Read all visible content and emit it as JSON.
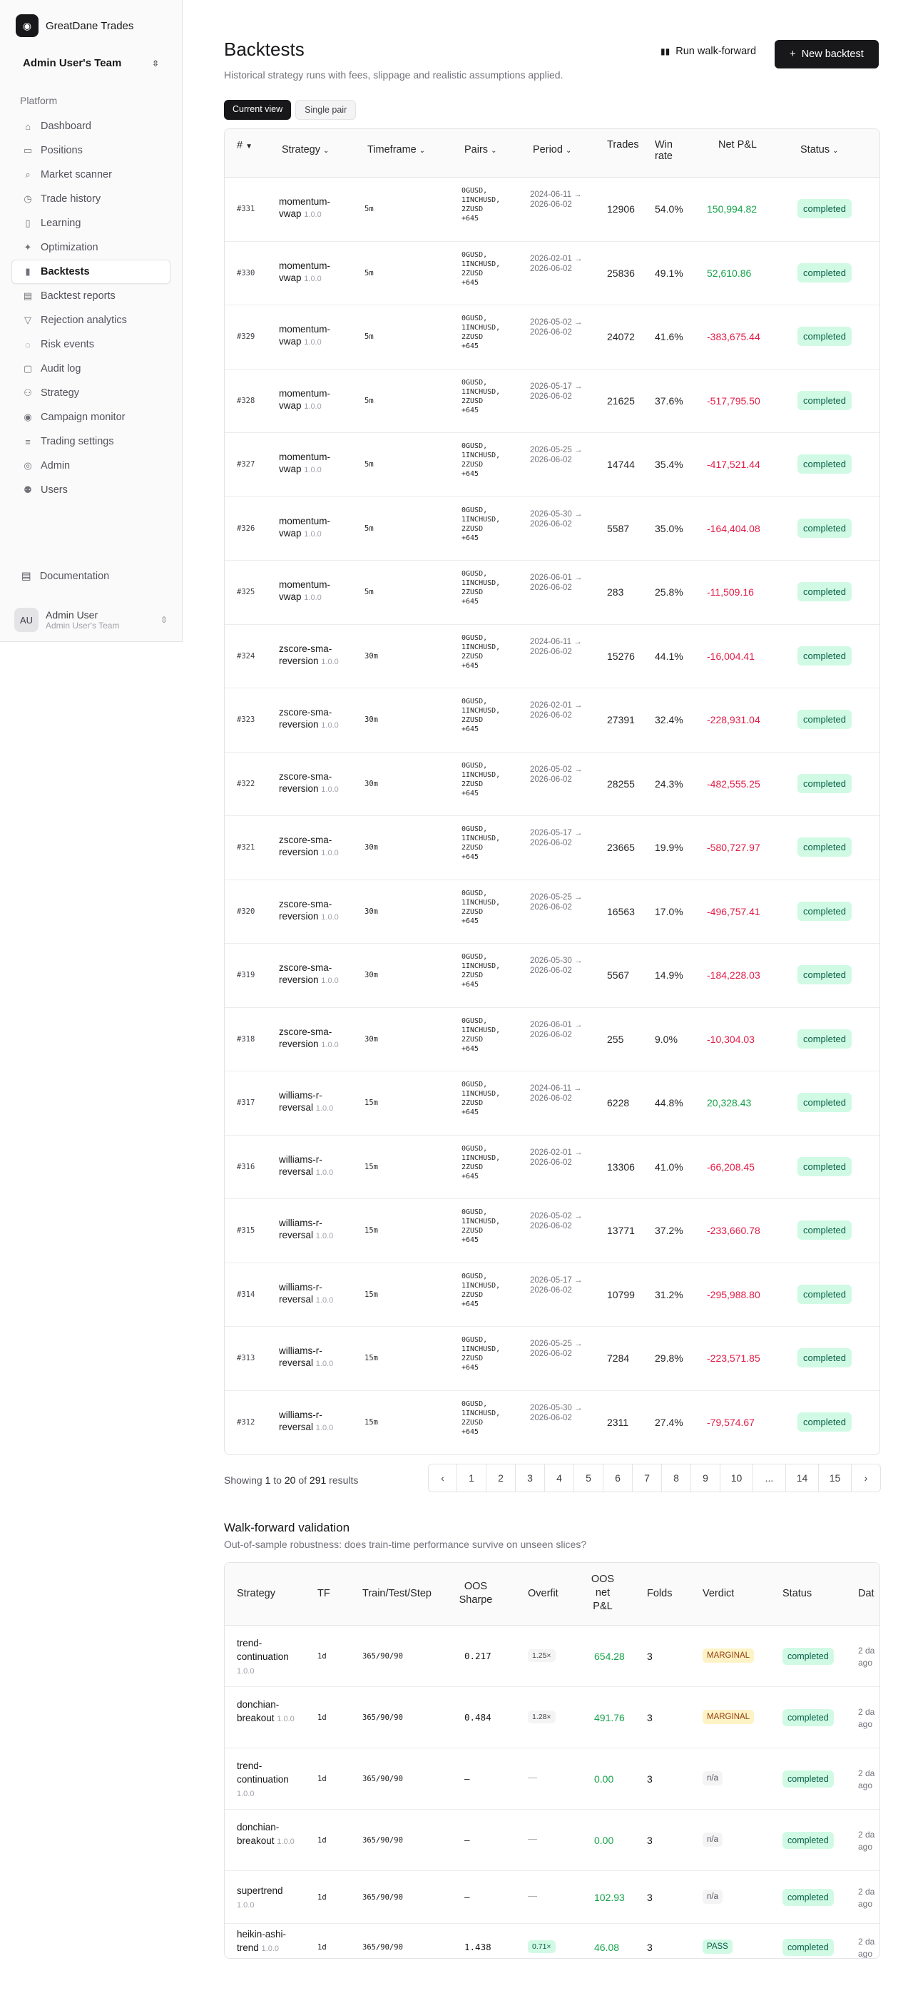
{
  "brand": {
    "name": "GreatDane Trades",
    "logo_icon": "dog-icon"
  },
  "team": {
    "name": "Admin User's Team"
  },
  "nav": {
    "section": "Platform",
    "items": [
      {
        "label": "Dashboard",
        "icon": "home-icon",
        "glyph": "⌂"
      },
      {
        "label": "Positions",
        "icon": "briefcase-icon",
        "glyph": "▭"
      },
      {
        "label": "Market scanner",
        "icon": "search-icon",
        "glyph": "⌕"
      },
      {
        "label": "Trade history",
        "icon": "clock-icon",
        "glyph": "◷"
      },
      {
        "label": "Learning",
        "icon": "book-icon",
        "glyph": "▯"
      },
      {
        "label": "Optimization",
        "icon": "sparkles-icon",
        "glyph": "✦"
      },
      {
        "label": "Backtests",
        "icon": "bar-chart-icon",
        "glyph": "▮",
        "active": true
      },
      {
        "label": "Backtest reports",
        "icon": "report-icon",
        "glyph": "▤"
      },
      {
        "label": "Rejection analytics",
        "icon": "filter-icon",
        "glyph": "▽"
      },
      {
        "label": "Risk events",
        "icon": "alert-icon",
        "glyph": "◌"
      },
      {
        "label": "Audit log",
        "icon": "file-icon",
        "glyph": "▢"
      },
      {
        "label": "Strategy",
        "icon": "strategy-icon",
        "glyph": "⚇"
      },
      {
        "label": "Campaign monitor",
        "icon": "radio-icon",
        "glyph": "◉"
      },
      {
        "label": "Trading settings",
        "icon": "sliders-icon",
        "glyph": "≡"
      },
      {
        "label": "Admin",
        "icon": "shield-icon",
        "glyph": "◎"
      },
      {
        "label": "Users",
        "icon": "users-icon",
        "glyph": "⚉"
      }
    ],
    "documentation": "Documentation"
  },
  "user": {
    "initials": "AU",
    "name": "Admin User",
    "team": "Admin User's Team"
  },
  "page": {
    "title": "Backtests",
    "subtitle": "Historical strategy runs with fees, slippage and realistic assumptions applied.",
    "walk_forward_button": "Run walk-forward",
    "new_button": "New backtest",
    "views": [
      "Current view",
      "Single pair"
    ]
  },
  "backtests": {
    "headers": {
      "id": "#",
      "strategy": "Strategy",
      "timeframe": "Timeframe",
      "pairs": "Pairs",
      "period": "Period",
      "trades": "Trades",
      "win_rate": "Win rate",
      "net_pnl": "Net P&L",
      "status": "Status"
    },
    "rows": [
      {
        "id": "#331",
        "strategy": "momentum-vwap",
        "version": "1.0.0",
        "tf": "5m",
        "pairs": "0GUSD,\n1INCHUSD,\n2ZUSD\n+645",
        "period": "2024-06-11 → 2026-06-02",
        "trades": "12906",
        "win": "54.0%",
        "pnl": "150,994.82",
        "sign": "pos",
        "status": "completed"
      },
      {
        "id": "#330",
        "strategy": "momentum-vwap",
        "version": "1.0.0",
        "tf": "5m",
        "pairs": "0GUSD,\n1INCHUSD,\n2ZUSD\n+645",
        "period": "2026-02-01 → 2026-06-02",
        "trades": "25836",
        "win": "49.1%",
        "pnl": "52,610.86",
        "sign": "pos",
        "status": "completed"
      },
      {
        "id": "#329",
        "strategy": "momentum-vwap",
        "version": "1.0.0",
        "tf": "5m",
        "pairs": "0GUSD,\n1INCHUSD,\n2ZUSD\n+645",
        "period": "2026-05-02 → 2026-06-02",
        "trades": "24072",
        "win": "41.6%",
        "pnl": "-383,675.44",
        "sign": "neg",
        "status": "completed"
      },
      {
        "id": "#328",
        "strategy": "momentum-vwap",
        "version": "1.0.0",
        "tf": "5m",
        "pairs": "0GUSD,\n1INCHUSD,\n2ZUSD\n+645",
        "period": "2026-05-17 → 2026-06-02",
        "trades": "21625",
        "win": "37.6%",
        "pnl": "-517,795.50",
        "sign": "neg",
        "status": "completed"
      },
      {
        "id": "#327",
        "strategy": "momentum-vwap",
        "version": "1.0.0",
        "tf": "5m",
        "pairs": "0GUSD,\n1INCHUSD,\n2ZUSD\n+645",
        "period": "2026-05-25 → 2026-06-02",
        "trades": "14744",
        "win": "35.4%",
        "pnl": "-417,521.44",
        "sign": "neg",
        "status": "completed"
      },
      {
        "id": "#326",
        "strategy": "momentum-vwap",
        "version": "1.0.0",
        "tf": "5m",
        "pairs": "0GUSD,\n1INCHUSD,\n2ZUSD\n+645",
        "period": "2026-05-30 → 2026-06-02",
        "trades": "5587",
        "win": "35.0%",
        "pnl": "-164,404.08",
        "sign": "neg",
        "status": "completed"
      },
      {
        "id": "#325",
        "strategy": "momentum-vwap",
        "version": "1.0.0",
        "tf": "5m",
        "pairs": "0GUSD,\n1INCHUSD,\n2ZUSD\n+645",
        "period": "2026-06-01 → 2026-06-02",
        "trades": "283",
        "win": "25.8%",
        "pnl": "-11,509.16",
        "sign": "neg",
        "status": "completed"
      },
      {
        "id": "#324",
        "strategy": "zscore-sma-reversion",
        "version": "1.0.0",
        "tf": "30m",
        "pairs": "0GUSD,\n1INCHUSD,\n2ZUSD\n+645",
        "period": "2024-06-11 → 2026-06-02",
        "trades": "15276",
        "win": "44.1%",
        "pnl": "-16,004.41",
        "sign": "neg",
        "status": "completed"
      },
      {
        "id": "#323",
        "strategy": "zscore-sma-reversion",
        "version": "1.0.0",
        "tf": "30m",
        "pairs": "0GUSD,\n1INCHUSD,\n2ZUSD\n+645",
        "period": "2026-02-01 → 2026-06-02",
        "trades": "27391",
        "win": "32.4%",
        "pnl": "-228,931.04",
        "sign": "neg",
        "status": "completed"
      },
      {
        "id": "#322",
        "strategy": "zscore-sma-reversion",
        "version": "1.0.0",
        "tf": "30m",
        "pairs": "0GUSD,\n1INCHUSD,\n2ZUSD\n+645",
        "period": "2026-05-02 → 2026-06-02",
        "trades": "28255",
        "win": "24.3%",
        "pnl": "-482,555.25",
        "sign": "neg",
        "status": "completed"
      },
      {
        "id": "#321",
        "strategy": "zscore-sma-reversion",
        "version": "1.0.0",
        "tf": "30m",
        "pairs": "0GUSD,\n1INCHUSD,\n2ZUSD\n+645",
        "period": "2026-05-17 → 2026-06-02",
        "trades": "23665",
        "win": "19.9%",
        "pnl": "-580,727.97",
        "sign": "neg",
        "status": "completed"
      },
      {
        "id": "#320",
        "strategy": "zscore-sma-reversion",
        "version": "1.0.0",
        "tf": "30m",
        "pairs": "0GUSD,\n1INCHUSD,\n2ZUSD\n+645",
        "period": "2026-05-25 → 2026-06-02",
        "trades": "16563",
        "win": "17.0%",
        "pnl": "-496,757.41",
        "sign": "neg",
        "status": "completed"
      },
      {
        "id": "#319",
        "strategy": "zscore-sma-reversion",
        "version": "1.0.0",
        "tf": "30m",
        "pairs": "0GUSD,\n1INCHUSD,\n2ZUSD\n+645",
        "period": "2026-05-30 → 2026-06-02",
        "trades": "5567",
        "win": "14.9%",
        "pnl": "-184,228.03",
        "sign": "neg",
        "status": "completed"
      },
      {
        "id": "#318",
        "strategy": "zscore-sma-reversion",
        "version": "1.0.0",
        "tf": "30m",
        "pairs": "0GUSD,\n1INCHUSD,\n2ZUSD\n+645",
        "period": "2026-06-01 → 2026-06-02",
        "trades": "255",
        "win": "9.0%",
        "pnl": "-10,304.03",
        "sign": "neg",
        "status": "completed"
      },
      {
        "id": "#317",
        "strategy": "williams-r-reversal",
        "version": "1.0.0",
        "tf": "15m",
        "pairs": "0GUSD,\n1INCHUSD,\n2ZUSD\n+645",
        "period": "2024-06-11 → 2026-06-02",
        "trades": "6228",
        "win": "44.8%",
        "pnl": "20,328.43",
        "sign": "pos",
        "status": "completed"
      },
      {
        "id": "#316",
        "strategy": "williams-r-reversal",
        "version": "1.0.0",
        "tf": "15m",
        "pairs": "0GUSD,\n1INCHUSD,\n2ZUSD\n+645",
        "period": "2026-02-01 → 2026-06-02",
        "trades": "13306",
        "win": "41.0%",
        "pnl": "-66,208.45",
        "sign": "neg",
        "status": "completed"
      },
      {
        "id": "#315",
        "strategy": "williams-r-reversal",
        "version": "1.0.0",
        "tf": "15m",
        "pairs": "0GUSD,\n1INCHUSD,\n2ZUSD\n+645",
        "period": "2026-05-02 → 2026-06-02",
        "trades": "13771",
        "win": "37.2%",
        "pnl": "-233,660.78",
        "sign": "neg",
        "status": "completed"
      },
      {
        "id": "#314",
        "strategy": "williams-r-reversal",
        "version": "1.0.0",
        "tf": "15m",
        "pairs": "0GUSD,\n1INCHUSD,\n2ZUSD\n+645",
        "period": "2026-05-17 → 2026-06-02",
        "trades": "10799",
        "win": "31.2%",
        "pnl": "-295,988.80",
        "sign": "neg",
        "status": "completed"
      },
      {
        "id": "#313",
        "strategy": "williams-r-reversal",
        "version": "1.0.0",
        "tf": "15m",
        "pairs": "0GUSD,\n1INCHUSD,\n2ZUSD\n+645",
        "period": "2026-05-25 → 2026-06-02",
        "trades": "7284",
        "win": "29.8%",
        "pnl": "-223,571.85",
        "sign": "neg",
        "status": "completed"
      },
      {
        "id": "#312",
        "strategy": "williams-r-reversal",
        "version": "1.0.0",
        "tf": "15m",
        "pairs": "0GUSD,\n1INCHUSD,\n2ZUSD\n+645",
        "period": "2026-05-30 → 2026-06-02",
        "trades": "2311",
        "win": "27.4%",
        "pnl": "-79,574.67",
        "sign": "neg",
        "status": "completed"
      }
    ]
  },
  "pagination": {
    "showing_prefix": "Showing",
    "from": "1",
    "to_word": "to",
    "to": "20",
    "of_word": "of",
    "total": "291",
    "suffix": "results",
    "pages": [
      "1",
      "2",
      "3",
      "4",
      "5",
      "6",
      "7",
      "8",
      "9",
      "10",
      "...",
      "14",
      "15"
    ]
  },
  "walk_forward": {
    "title": "Walk-forward validation",
    "subtitle": "Out-of-sample robustness: does train-time performance survive on unseen slices?",
    "headers": {
      "strategy": "Strategy",
      "tf": "TF",
      "tts": "Train/Test/Step",
      "sharpe": "OOS Sharpe",
      "overfit": "Overfit",
      "oos_pnl": "OOS net P&L",
      "folds": "Folds",
      "verdict": "Verdict",
      "status": "Status",
      "date": "Dat"
    },
    "rows": [
      {
        "strategy": "trend-continuation",
        "version": "1.0.0",
        "tf": "1d",
        "tts": "365/90/90",
        "sharpe": "0.217",
        "overfit": "1.25×",
        "overfit_style": "grey",
        "oos": "654.28",
        "folds": "3",
        "verdict": "MARGINAL",
        "verdict_style": "v-marg",
        "status": "completed",
        "date": "2 da ago"
      },
      {
        "strategy": "donchian-breakout",
        "version": "1.0.0",
        "tf": "1d",
        "tts": "365/90/90",
        "sharpe": "0.484",
        "overfit": "1.28×",
        "overfit_style": "grey",
        "oos": "491.76",
        "folds": "3",
        "verdict": "MARGINAL",
        "verdict_style": "v-marg",
        "status": "completed",
        "date": "2 da ago"
      },
      {
        "strategy": "trend-continuation",
        "version": "1.0.0",
        "tf": "1d",
        "tts": "365/90/90",
        "sharpe": "—",
        "overfit": "—",
        "overfit_style": "dash",
        "oos": "0.00",
        "folds": "3",
        "verdict": "n/a",
        "verdict_style": "v-na",
        "status": "completed",
        "date": "2 da ago"
      },
      {
        "strategy": "donchian-breakout",
        "version": "1.0.0",
        "tf": "1d",
        "tts": "365/90/90",
        "sharpe": "—",
        "overfit": "—",
        "overfit_style": "dash",
        "oos": "0.00",
        "folds": "3",
        "verdict": "n/a",
        "verdict_style": "v-na",
        "status": "completed",
        "date": "2 da ago"
      },
      {
        "strategy": "supertrend",
        "version": "1.0.0",
        "tf": "1d",
        "tts": "365/90/90",
        "sharpe": "—",
        "overfit": "—",
        "overfit_style": "dash",
        "oos": "102.93",
        "folds": "3",
        "verdict": "n/a",
        "verdict_style": "v-na",
        "status": "completed",
        "date": "2 da ago"
      },
      {
        "strategy": "heikin-ashi-trend",
        "version": "1.0.0",
        "tf": "1d",
        "tts": "365/90/90",
        "sharpe": "1.438",
        "overfit": "0.71×",
        "overfit_style": "green",
        "oos": "46.08",
        "folds": "3",
        "verdict": "PASS",
        "verdict_style": "v-pass",
        "status": "completed",
        "date": "2 da ago"
      }
    ]
  },
  "colors": {
    "accent": "#18181b",
    "positive": "#15a34a",
    "negative": "#e11d48",
    "status_bg": "#d1fae5"
  }
}
